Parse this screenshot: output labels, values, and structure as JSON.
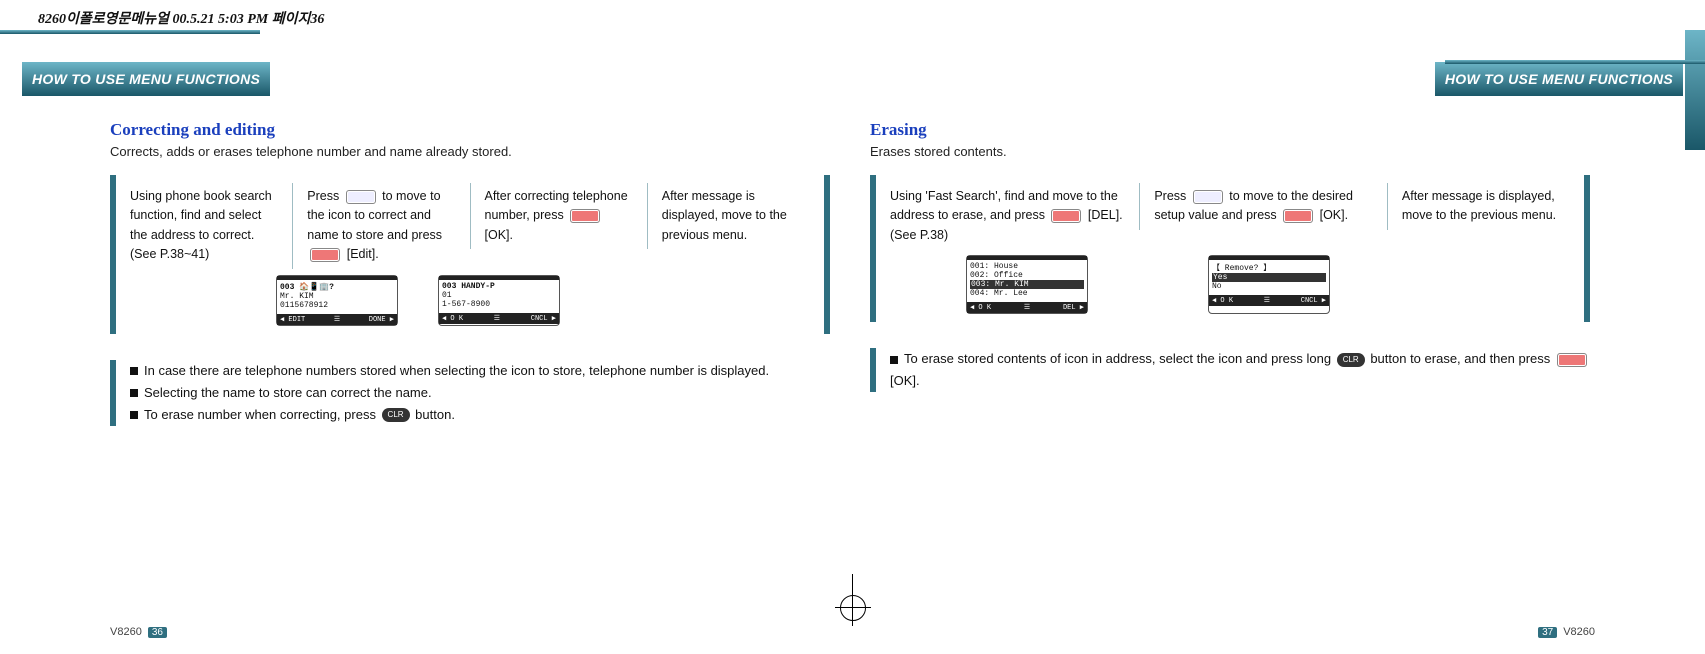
{
  "doc_header": "8260이폴로영문메뉴얼   00.5.21 5:03 PM  페이지36",
  "tab_label": "HOW TO USE MENU FUNCTIONS",
  "left": {
    "title": "Correcting and editing",
    "desc": "Corrects, adds or erases telephone number and name already stored.",
    "steps": [
      "Using phone book search function, find and select the address to correct. (See P.38~41)",
      "Press {nav} to move to the icon to correct and name to store and press {key} [Edit].",
      "After correcting telephone number, press {key} [OK].",
      "After message is displayed, move to the previous menu."
    ],
    "screens": [
      {
        "top": "003",
        "lines": [
          "Mr. KIM",
          "",
          "0115678912"
        ],
        "left_btn": "EDIT",
        "right_btn": "DONE",
        "icons": "🏠📱🏢?"
      },
      {
        "top": "003   HANDY-P",
        "lines": [
          "01",
          "1-567-8900"
        ],
        "left_btn": "O K",
        "right_btn": "CNCL"
      }
    ],
    "notes": [
      "In case there are telephone numbers stored when selecting the icon to store, telephone number is displayed.",
      "Selecting the name to store can correct the name.",
      "To erase number when correcting, press {clr} button."
    ]
  },
  "right": {
    "title": "Erasing",
    "desc": "Erases stored contents.",
    "steps": [
      "Using 'Fast Search', find and move to the address to erase, and press {key} [DEL]. (See  P.38)",
      "Press {nav} to move to the desired setup value and press {key} [OK].",
      "After message is displayed, move to the previous menu."
    ],
    "screens": [
      {
        "lines": [
          "001: House",
          "002: Office",
          "{sel}003: Mr. KIM",
          "004: Mr. Lee"
        ],
        "left_btn": "O K",
        "right_btn": "DEL"
      },
      {
        "lines": [
          "",
          "【 Remove? 】",
          "{sel}Yes",
          "No"
        ],
        "left_btn": "O K",
        "right_btn": "CNCL"
      }
    ],
    "notes": [
      "To erase stored contents of icon in address, select the icon and  press long {clr} button to erase, and then press {key} [OK]."
    ]
  },
  "clr_label": "CLR",
  "footer_model": "V8260",
  "page_left": "36",
  "page_right": "37"
}
